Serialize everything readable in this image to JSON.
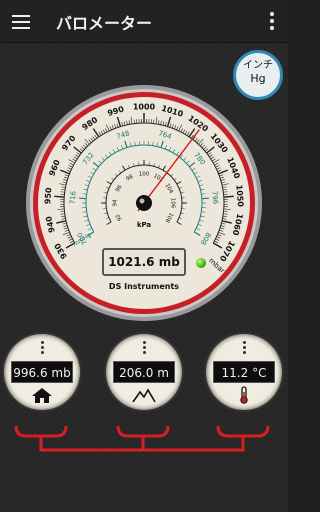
{
  "app": {
    "title": "バロメーター"
  },
  "unit_toggle": {
    "line1": "インチ",
    "line2": "Hg"
  },
  "main_gauge": {
    "outer_scale": {
      "unit": "mbar",
      "label_left": "mmHg",
      "min": 930,
      "max": 1070,
      "labels": [
        "930",
        "940",
        "950",
        "960",
        "970",
        "980",
        "990",
        "1000",
        "1010",
        "1020",
        "1030",
        "1040",
        "1050",
        "1060",
        "1070"
      ]
    },
    "middle_scale": {
      "labels": [
        "700",
        "716",
        "732",
        "748",
        "764",
        "780",
        "796",
        "808"
      ]
    },
    "inner_scale": {
      "unit": "kPa",
      "labels": [
        "92",
        "94",
        "96",
        "98",
        "100",
        "102",
        "104",
        "106",
        "108"
      ]
    },
    "needle_value_mbar": 1021.6,
    "reading": "1021.6 mb",
    "brand": "DS Instruments",
    "colors": {
      "outer_ring": "#c62026",
      "needle": "#d0201a",
      "middle_scale": "#1c7a78",
      "led": "#2fa300"
    }
  },
  "small_gauges": [
    {
      "value": "996.6 mb",
      "icon": "home-icon"
    },
    {
      "value": "206.0 m",
      "icon": "mountain-icon"
    },
    {
      "value": "11.2 °C",
      "icon": "thermometer-icon"
    }
  ]
}
